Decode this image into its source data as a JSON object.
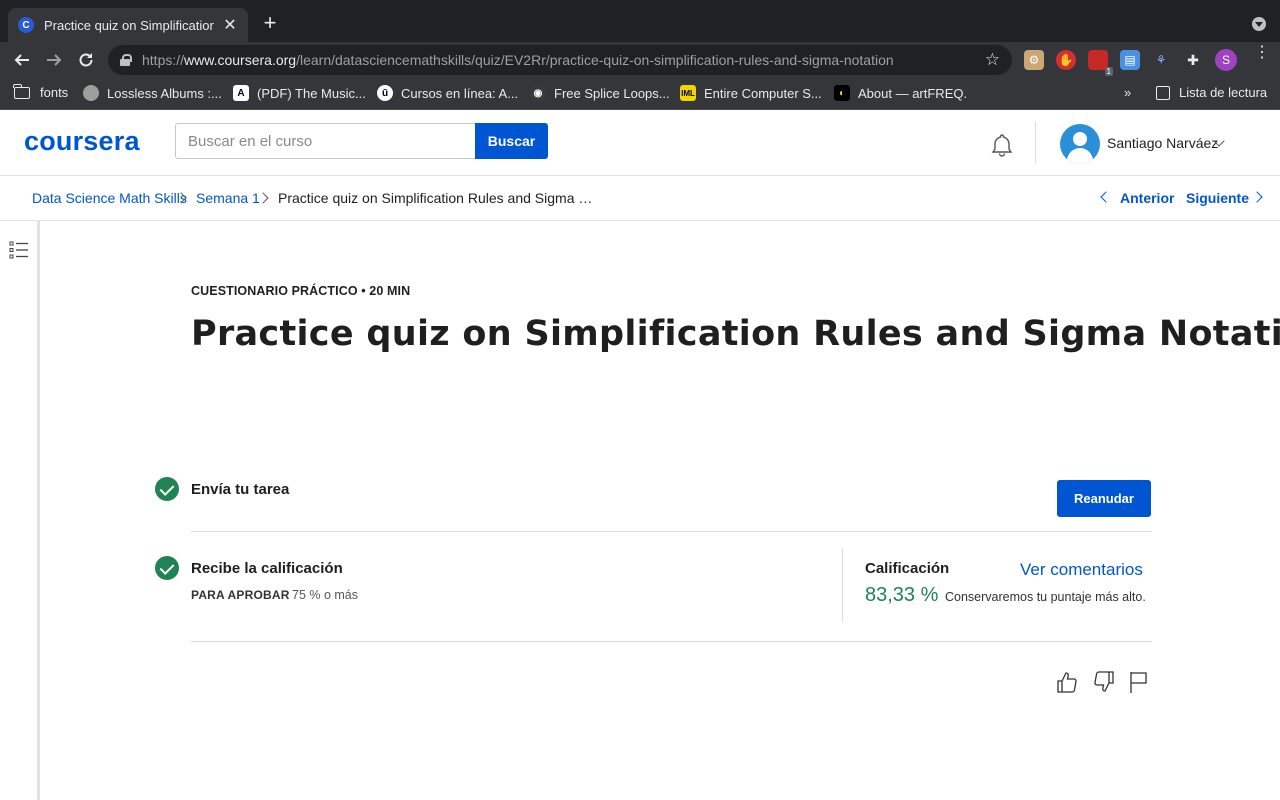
{
  "browser": {
    "tab_title": "Practice quiz on Simplification",
    "tab_favicon_letter": "C",
    "url_prefix": "https://",
    "url_host": "www.coursera.org",
    "url_path": "/learn/datasciencemathskills/quiz/EV2Rr/practice-quiz-on-simplification-rules-and-sigma-notation",
    "profile_letter": "S",
    "extension_badge": "1",
    "bookmarks": [
      {
        "label": "fonts",
        "icon": "folder-icon"
      },
      {
        "label": "Lossless Albums :...",
        "icon": "globe-icon"
      },
      {
        "label": "(PDF) The Music...",
        "icon": "academia-icon"
      },
      {
        "label": "Cursos en línea: A...",
        "icon": "udemy-icon"
      },
      {
        "label": "Free Splice Loops...",
        "icon": "splice-icon"
      },
      {
        "label": "Entire Computer S...",
        "icon": "iml-icon"
      },
      {
        "label": "About — artFREQ.",
        "icon": "artfreq-icon"
      }
    ],
    "reading_list": "Lista de lectura"
  },
  "header": {
    "logo": "coursera",
    "search_placeholder": "Buscar en el curso",
    "search_button": "Buscar",
    "user_name": "Santiago Narváez"
  },
  "breadcrumb": {
    "items": [
      "Data Science Math Skills",
      "Semana 1",
      "Practice quiz on Simplification Rules and Sigma …"
    ],
    "prev": "Anterior",
    "next": "Siguiente"
  },
  "quiz": {
    "eyebrow": "CUESTIONARIO PRÁCTICO • 20 MIN",
    "title": "Practice quiz on Simplification Rules and Sigma Notation",
    "step1_label": "Envía tu tarea",
    "resume_button": "Reanudar",
    "step2_label": "Recibe la calificación",
    "pass_label": "PARA APROBAR",
    "pass_value": "75 % o más",
    "grade_label": "Calificación",
    "grade_value": "83,33 %",
    "grade_note": "Conservaremos tu puntaje más alto.",
    "feedback_link": "Ver comentarios"
  },
  "colors": {
    "brand": "#0056d2",
    "success": "#1f8354"
  }
}
